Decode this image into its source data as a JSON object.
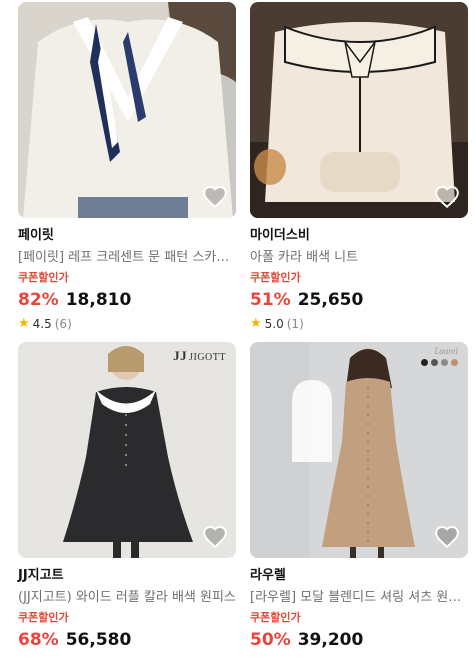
{
  "products": [
    {
      "brand": "페이릿",
      "title": "[페이릿] 레프 크레센트 문 패턴 스카프 블라우스",
      "coupon_label": "쿠폰할인가",
      "discount": "82%",
      "price": "18,810",
      "rating": "4.5",
      "review_count": "(6)"
    },
    {
      "brand": "마이더스비",
      "title": "아폴 카라 배색 니트",
      "coupon_label": "쿠폰할인가",
      "discount": "51%",
      "price": "25,650",
      "rating": "5.0",
      "review_count": "(1)"
    },
    {
      "brand": "JJ지고트",
      "title": "(JJ지고트) 와이드 러플 칼라 배색 원피스",
      "coupon_label": "쿠폰할인가",
      "discount": "68%",
      "price": "56,580",
      "watermark_big": "JJ",
      "watermark_small": "JIGOTT"
    },
    {
      "brand": "라우렐",
      "title": "[라우렐] 모달 블렌디드 셔링 셔츠 원피스",
      "coupon_label": "쿠폰할인가",
      "discount": "50%",
      "price": "39,200",
      "watermark": "Laurel"
    }
  ],
  "icons": {
    "wishlist": "heart-outline-icon",
    "rating": "star-icon"
  },
  "colors": {
    "discount": "#e8463a",
    "star": "#f5b400",
    "subtitle": "#6f6f6f"
  }
}
